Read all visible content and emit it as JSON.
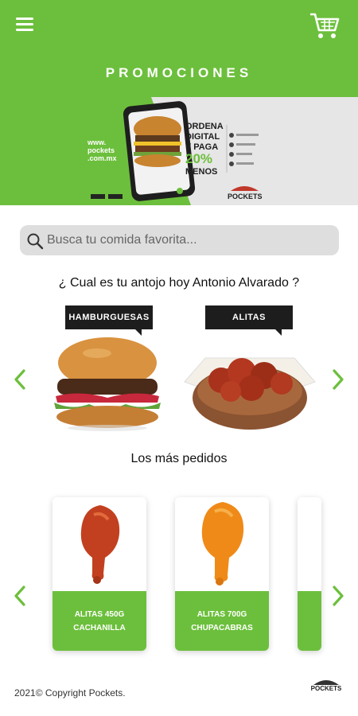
{
  "header": {
    "title": "PROMOCIONES",
    "brand_color": "#6cbf3c"
  },
  "banner": {
    "site": "www.\npockets\n.com.mx",
    "headline_1": "ORDENA",
    "headline_2": "DIGITAL",
    "headline_3": "Y PAGA",
    "discount": "20%",
    "headline_4": "MENOS",
    "brand": "POCKETS"
  },
  "search": {
    "placeholder": "Busca tu comida favorita..."
  },
  "greeting": "¿ Cual es tu antojo hoy Antonio Alvarado ?",
  "categories": [
    {
      "label": "HAMBURGUESAS"
    },
    {
      "label": "ALITAS"
    }
  ],
  "popular": {
    "title": "Los más pedidos",
    "items": [
      {
        "name": "ALITAS 450G CACHANILLA"
      },
      {
        "name": "ALITAS 700G CHUPACABRAS"
      }
    ]
  },
  "footer": {
    "copyright": "2021© Copyright Pockets.",
    "logo_text": "POCKETS"
  }
}
